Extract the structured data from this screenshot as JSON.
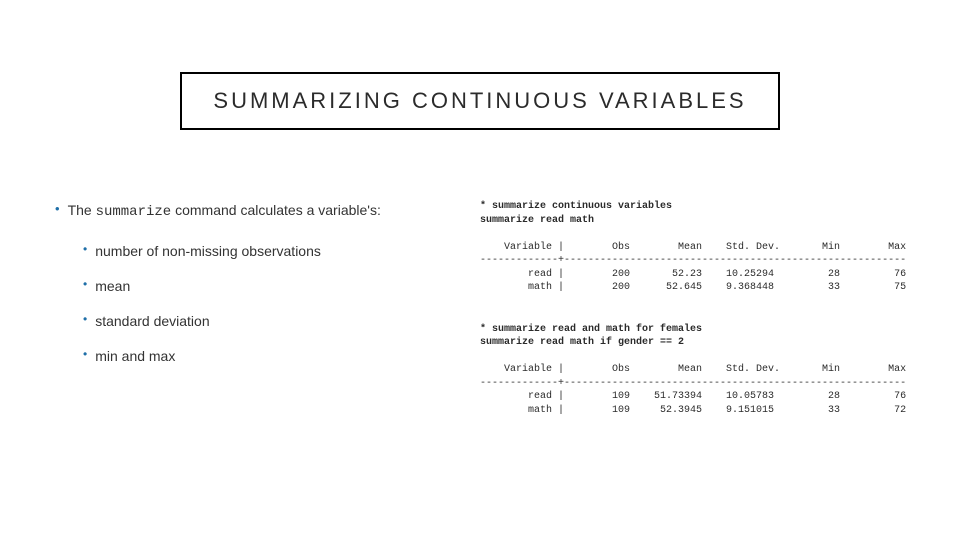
{
  "title": "SUMMARIZING CONTINUOUS VARIABLES",
  "left": {
    "intro_pre": "The ",
    "intro_cmd": "summarize",
    "intro_post": " command calculates a variable's:",
    "sub1": "number of non-missing observations",
    "sub2": "mean",
    "sub3": "standard deviation",
    "sub4": "min and max"
  },
  "code1": {
    "comment": "* summarize continuous variables",
    "cmd": "summarize read math",
    "table": "    Variable |        Obs        Mean    Std. Dev.       Min        Max\n-------------+---------------------------------------------------------\n        read |        200       52.23    10.25294         28         76\n        math |        200      52.645    9.368448         33         75"
  },
  "code2": {
    "comment": "* summarize read and math for females",
    "cmd": "summarize read math if gender == 2",
    "table": "    Variable |        Obs        Mean    Std. Dev.       Min        Max\n-------------+---------------------------------------------------------\n        read |        109    51.73394    10.05783         28         76\n        math |        109     52.3945    9.151015         33         72"
  },
  "chart_data": [
    {
      "type": "table",
      "title": "summarize read math",
      "columns": [
        "Variable",
        "Obs",
        "Mean",
        "Std. Dev.",
        "Min",
        "Max"
      ],
      "rows": [
        {
          "Variable": "read",
          "Obs": 200,
          "Mean": 52.23,
          "Std. Dev.": 10.25294,
          "Min": 28,
          "Max": 76
        },
        {
          "Variable": "math",
          "Obs": 200,
          "Mean": 52.645,
          "Std. Dev.": 9.368448,
          "Min": 33,
          "Max": 75
        }
      ]
    },
    {
      "type": "table",
      "title": "summarize read math if gender == 2",
      "columns": [
        "Variable",
        "Obs",
        "Mean",
        "Std. Dev.",
        "Min",
        "Max"
      ],
      "rows": [
        {
          "Variable": "read",
          "Obs": 109,
          "Mean": 51.73394,
          "Std. Dev.": 10.05783,
          "Min": 28,
          "Max": 76
        },
        {
          "Variable": "math",
          "Obs": 109,
          "Mean": 52.3945,
          "Std. Dev.": 9.151015,
          "Min": 33,
          "Max": 72
        }
      ]
    }
  ]
}
